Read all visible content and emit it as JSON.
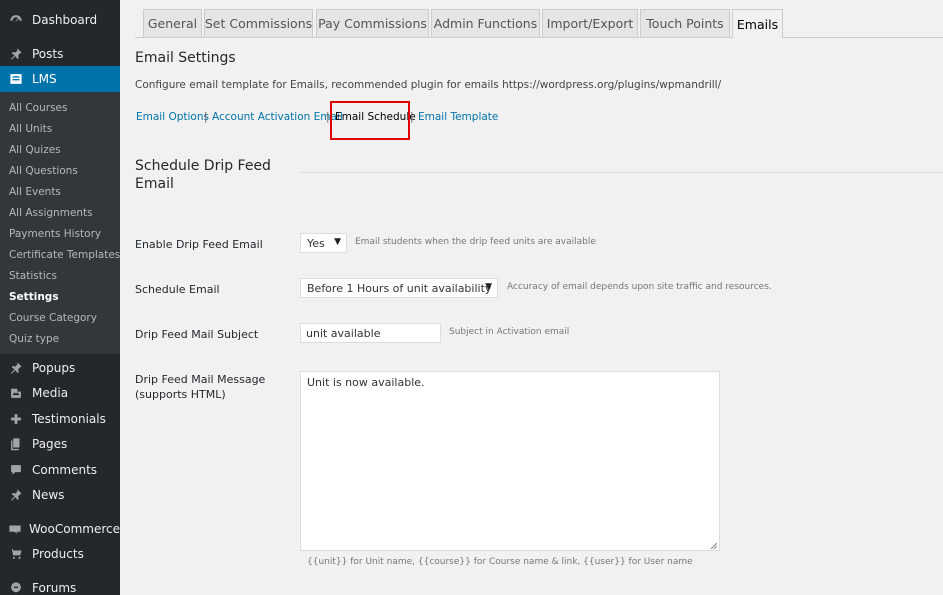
{
  "sidebar": {
    "top_items": [
      {
        "label": "Dashboard",
        "icon": "dashboard-icon"
      },
      {
        "label": "Posts",
        "icon": "pin-icon"
      },
      {
        "label": "LMS",
        "icon": "lms-icon"
      }
    ],
    "submenu": [
      "All Courses",
      "All Units",
      "All Quizes",
      "All Questions",
      "All Events",
      "All Assignments",
      "Payments History",
      "Certificate Templates",
      "Statistics",
      "Settings",
      "Course Category",
      "Quiz type"
    ],
    "bottom_items": [
      {
        "label": "Popups",
        "icon": "pin-icon"
      },
      {
        "label": "Media",
        "icon": "media-icon"
      },
      {
        "label": "Testimonials",
        "icon": "plus-icon"
      },
      {
        "label": "Pages",
        "icon": "pages-icon"
      },
      {
        "label": "Comments",
        "icon": "comment-icon"
      },
      {
        "label": "News",
        "icon": "pin-icon"
      },
      {
        "label": "WooCommerce",
        "icon": "woocommerce-icon"
      },
      {
        "label": "Products",
        "icon": "cart-icon"
      },
      {
        "label": "Forums",
        "icon": "forums-icon"
      }
    ]
  },
  "tabs": [
    "General",
    "Set Commissions",
    "Pay Commissions",
    "Admin Functions",
    "Import/Export",
    "Touch Points",
    "Emails"
  ],
  "page": {
    "title": "Email Settings",
    "description": "Configure email template for Emails, recommended plugin for emails https://wordpress.org/plugins/wpmandrill/"
  },
  "subnav": [
    "Email Options",
    "Account Activation Email",
    "Email Schedule",
    "Email Template"
  ],
  "section_title": "Schedule Drip Feed Email",
  "fields": {
    "drip_enable": {
      "label": "Enable Drip Feed Email",
      "value": "Yes",
      "help": "Email students when the drip feed units are available"
    },
    "schedule": {
      "label": "Schedule Email",
      "value": "Before 1 Hours of unit availability",
      "help": "Accuracy of email depends upon site traffic and resources."
    },
    "subject": {
      "label": "Drip Feed Mail Subject",
      "value": "unit available",
      "help": "Subject in Activation email"
    },
    "message": {
      "label_line1": "Drip Feed Mail Message",
      "label_line2": "(supports HTML)",
      "value": "Unit is now available.",
      "help": "{{unit}} for Unit name, {{course}} for Course name & link, {{user}} for User name"
    }
  }
}
